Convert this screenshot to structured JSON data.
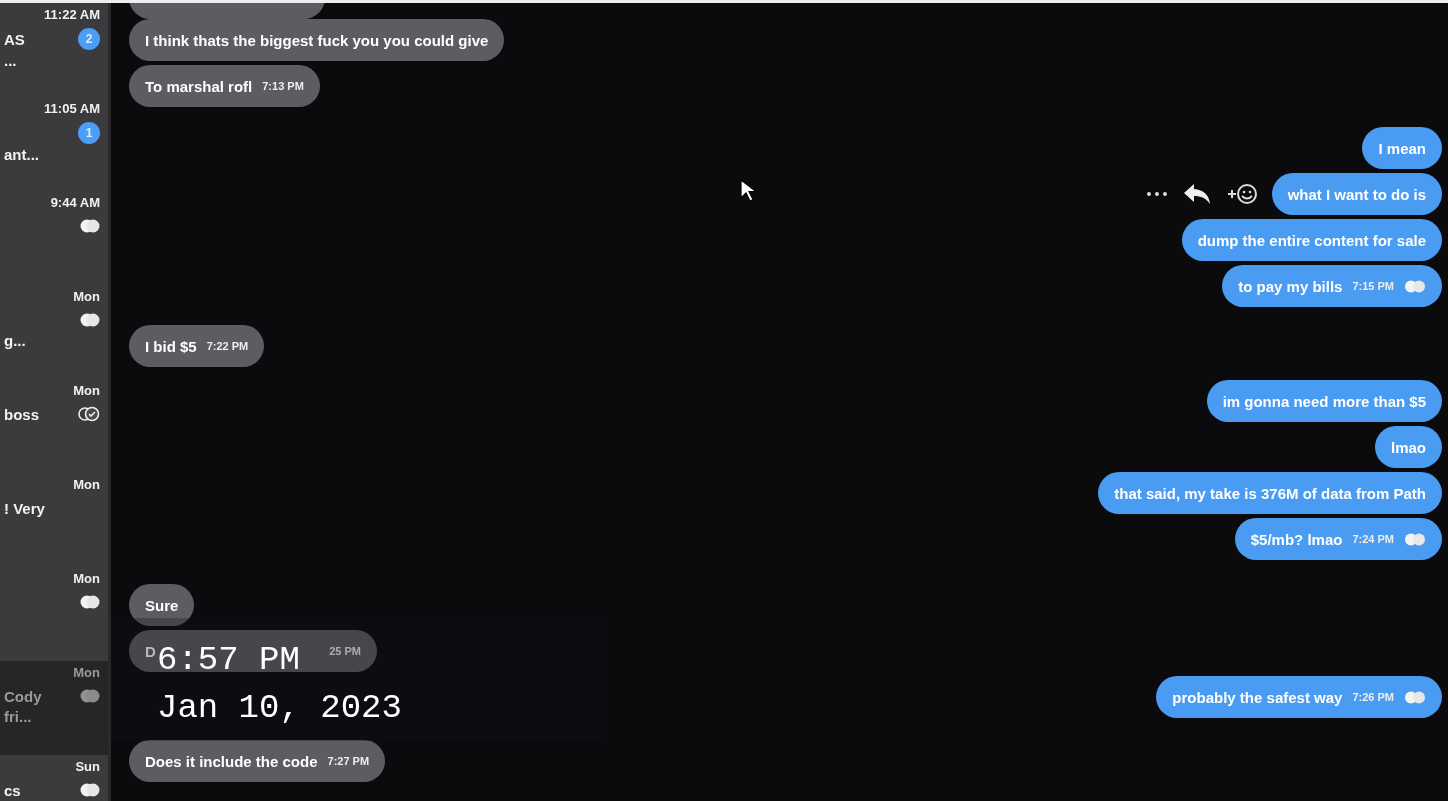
{
  "sidebar": {
    "conversations": [
      {
        "time": "11:22 AM",
        "name": "AS",
        "snippet": "...",
        "status": {
          "kind": "unread",
          "count": "2"
        },
        "selected": false
      },
      {
        "time": "11:05 AM",
        "snippet": "ant...",
        "status": {
          "kind": "unread",
          "count": "1"
        },
        "selected": false
      },
      {
        "time": "9:44 AM",
        "status": {
          "kind": "read"
        },
        "selected": false
      },
      {
        "time": "Mon",
        "snippet": "g...",
        "status": {
          "kind": "read"
        },
        "selected": false
      },
      {
        "time": "Mon",
        "name": "boss",
        "status": {
          "kind": "delivered"
        },
        "selected": false
      },
      {
        "time": "Mon",
        "name": "! Very",
        "selected": false
      },
      {
        "time": "Mon",
        "status": {
          "kind": "read"
        },
        "selected": false
      },
      {
        "time": "Mon",
        "name": "Cody",
        "snippet": "fri...",
        "status": {
          "kind": "read"
        },
        "selected": true
      },
      {
        "time": "Sun",
        "name": "cs",
        "status": {
          "kind": "read"
        },
        "selected": false
      }
    ]
  },
  "messages": [
    {
      "kind": "incoming",
      "bubbles": [
        {
          "text": "I think thats the biggest fuck you you could give"
        },
        {
          "text": "To marshal rofl",
          "time": "7:13 PM"
        }
      ]
    },
    {
      "kind": "outgoing",
      "bubbles": [
        {
          "text": "I mean"
        },
        {
          "text": "what I want to do is",
          "hovered": true
        },
        {
          "text": "dump the entire content for sale"
        },
        {
          "text": "to pay my bills",
          "time": "7:15 PM",
          "seen": true
        }
      ]
    },
    {
      "kind": "incoming",
      "bubbles": [
        {
          "text": "I bid $5",
          "time": "7:22 PM"
        }
      ]
    },
    {
      "kind": "outgoing",
      "bubbles": [
        {
          "text": "im gonna need more than $5"
        },
        {
          "text": "lmao"
        },
        {
          "text": "that said, my take is 376M of data from Path"
        },
        {
          "text": "$5/mb? lmao",
          "time": "7:24 PM",
          "seen": true
        }
      ]
    },
    {
      "kind": "incoming",
      "bubbles": [
        {
          "text": "Sure"
        },
        {
          "text": "D",
          "time": "25 PM"
        }
      ]
    },
    {
      "kind": "outgoing",
      "bubbles": [
        {
          "text": "probably the safest way",
          "time": "7:26 PM",
          "seen": true
        }
      ]
    },
    {
      "kind": "incoming",
      "bubbles": [
        {
          "text": "Does it include the code",
          "time": "7:27 PM"
        }
      ]
    }
  ],
  "overlay": {
    "time": "6:57 PM",
    "date": "Jan 10, 2023"
  }
}
